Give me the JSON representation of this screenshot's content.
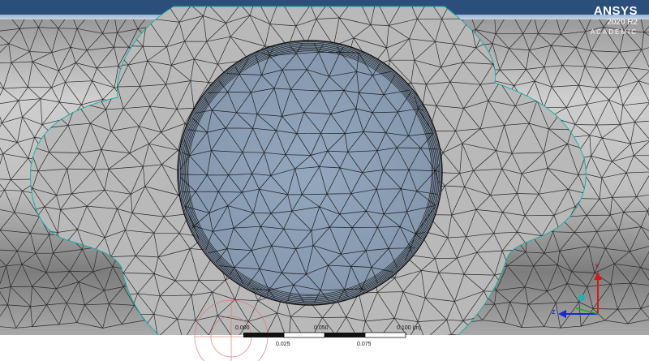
{
  "logo": {
    "brand": "ANSYS",
    "version": "2020 R2",
    "edition": "ACADEMIC"
  },
  "scale_bar": {
    "top_labels": [
      "0.000",
      "0.050",
      "0.100 (m)"
    ],
    "bottom_labels": [
      "0.025",
      "0.075"
    ]
  },
  "triad": {
    "x_label": "X",
    "y_label": "Y",
    "z_label": "Z"
  },
  "colors": {
    "mesh_gray": "#b9b9b9",
    "mesh_lines": "#2a2a2a",
    "inner_face": "#8ea2b9",
    "background_top": "#2b4e7a",
    "axis_red": "#d01a1a",
    "axis_blue": "#1a2ad0",
    "axis_green": "#18a818",
    "center_sphere": "#19b3b3"
  },
  "icons": {
    "triad": "axes-triad-icon",
    "probe": "crosshair-icon"
  }
}
